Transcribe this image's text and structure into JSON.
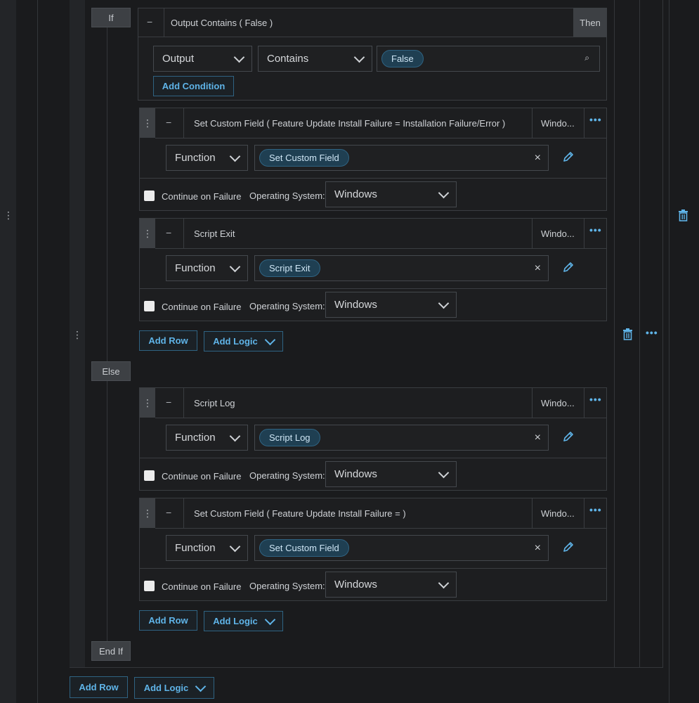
{
  "labels": {
    "if": "If",
    "else": "Else",
    "end_if": "End If",
    "then": "Then"
  },
  "condition": {
    "title": "Output Contains ( False )",
    "field": "Output",
    "operator": "Contains",
    "value_chip": "False",
    "add_condition": "Add Condition"
  },
  "rows": [
    {
      "title": "Set Custom Field ( Feature Update Install Failure = Installation Failure/Error )",
      "os_short": "Windo...",
      "function_label": "Function",
      "function_chip": "Set Custom Field",
      "continue_label": "Continue on Failure",
      "os_label": "Operating System:",
      "os_value": "Windows"
    },
    {
      "title": "Script Exit",
      "os_short": "Windo...",
      "function_label": "Function",
      "function_chip": "Script Exit",
      "continue_label": "Continue on Failure",
      "os_label": "Operating System:",
      "os_value": "Windows"
    },
    {
      "title": "Script Log",
      "os_short": "Windo...",
      "function_label": "Function",
      "function_chip": "Script Log",
      "continue_label": "Continue on Failure",
      "os_label": "Operating System:",
      "os_value": "Windows"
    },
    {
      "title": "Set Custom Field ( Feature Update Install Failure = )",
      "os_short": "Windo...",
      "function_label": "Function",
      "function_chip": "Set Custom Field",
      "continue_label": "Continue on Failure",
      "os_label": "Operating System:",
      "os_value": "Windows"
    }
  ],
  "buttons": {
    "add_row": "Add Row",
    "add_logic": "Add Logic"
  },
  "glyphs": {
    "dots": "⋮",
    "minus": "−",
    "ellipsis": "•••",
    "close": "×",
    "search": "⌕"
  }
}
